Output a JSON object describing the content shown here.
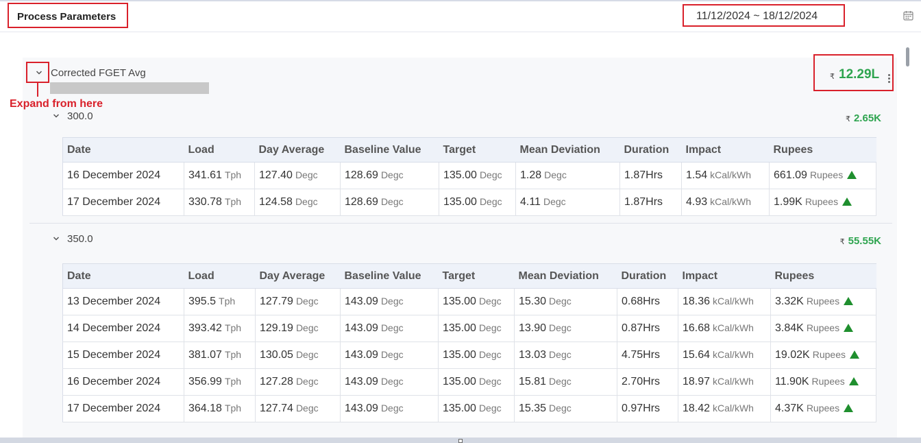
{
  "header": {
    "title": "Process Parameters",
    "date_range": "11/12/2024 ~ 18/12/2024"
  },
  "group": {
    "label": "Corrected FGET Avg",
    "currency_symbol": "₹",
    "total": "12.29L",
    "annotation": "Expand from here"
  },
  "columns": [
    "Date",
    "Load",
    "Day Average",
    "Baseline Value",
    "Target",
    "Mean Deviation",
    "Duration",
    "Impact",
    "Rupees"
  ],
  "sections": [
    {
      "label": "300.0",
      "amount": "2.65K",
      "rows": [
        {
          "date": "16 December 2024",
          "load": "341.61",
          "load_unit": "Tph",
          "day_avg": "127.40",
          "day_avg_unit": "Degc",
          "baseline": "128.69",
          "baseline_unit": "Degc",
          "target": "135.00",
          "target_unit": "Degc",
          "mean_dev": "1.28",
          "mean_dev_unit": "Degc",
          "duration": "1.87Hrs",
          "impact": "1.54",
          "impact_unit": "kCal/kWh",
          "rupees": "661.09",
          "rupees_unit": "Rupees"
        },
        {
          "date": "17 December 2024",
          "load": "330.78",
          "load_unit": "Tph",
          "day_avg": "124.58",
          "day_avg_unit": "Degc",
          "baseline": "128.69",
          "baseline_unit": "Degc",
          "target": "135.00",
          "target_unit": "Degc",
          "mean_dev": "4.11",
          "mean_dev_unit": "Degc",
          "duration": "1.87Hrs",
          "impact": "4.93",
          "impact_unit": "kCal/kWh",
          "rupees": "1.99K",
          "rupees_unit": "Rupees"
        }
      ]
    },
    {
      "label": "350.0",
      "amount": "55.55K",
      "rows": [
        {
          "date": "13 December 2024",
          "load": "395.5",
          "load_unit": "Tph",
          "day_avg": "127.79",
          "day_avg_unit": "Degc",
          "baseline": "143.09",
          "baseline_unit": "Degc",
          "target": "135.00",
          "target_unit": "Degc",
          "mean_dev": "15.30",
          "mean_dev_unit": "Degc",
          "duration": "0.68Hrs",
          "impact": "18.36",
          "impact_unit": "kCal/kWh",
          "rupees": "3.32K",
          "rupees_unit": "Rupees"
        },
        {
          "date": "14 December 2024",
          "load": "393.42",
          "load_unit": "Tph",
          "day_avg": "129.19",
          "day_avg_unit": "Degc",
          "baseline": "143.09",
          "baseline_unit": "Degc",
          "target": "135.00",
          "target_unit": "Degc",
          "mean_dev": "13.90",
          "mean_dev_unit": "Degc",
          "duration": "0.87Hrs",
          "impact": "16.68",
          "impact_unit": "kCal/kWh",
          "rupees": "3.84K",
          "rupees_unit": "Rupees"
        },
        {
          "date": "15 December 2024",
          "load": "381.07",
          "load_unit": "Tph",
          "day_avg": "130.05",
          "day_avg_unit": "Degc",
          "baseline": "143.09",
          "baseline_unit": "Degc",
          "target": "135.00",
          "target_unit": "Degc",
          "mean_dev": "13.03",
          "mean_dev_unit": "Degc",
          "duration": "4.75Hrs",
          "impact": "15.64",
          "impact_unit": "kCal/kWh",
          "rupees": "19.02K",
          "rupees_unit": "Rupees"
        },
        {
          "date": "16 December 2024",
          "load": "356.99",
          "load_unit": "Tph",
          "day_avg": "127.28",
          "day_avg_unit": "Degc",
          "baseline": "143.09",
          "baseline_unit": "Degc",
          "target": "135.00",
          "target_unit": "Degc",
          "mean_dev": "15.81",
          "mean_dev_unit": "Degc",
          "duration": "2.70Hrs",
          "impact": "18.97",
          "impact_unit": "kCal/kWh",
          "rupees": "11.90K",
          "rupees_unit": "Rupees"
        },
        {
          "date": "17 December 2024",
          "load": "364.18",
          "load_unit": "Tph",
          "day_avg": "127.74",
          "day_avg_unit": "Degc",
          "baseline": "143.09",
          "baseline_unit": "Degc",
          "target": "135.00",
          "target_unit": "Degc",
          "mean_dev": "15.35",
          "mean_dev_unit": "Degc",
          "duration": "0.97Hrs",
          "impact": "18.42",
          "impact_unit": "kCal/kWh",
          "rupees": "4.37K",
          "rupees_unit": "Rupees"
        }
      ]
    }
  ],
  "colors": {
    "positive": "#2ea44f",
    "annotation": "#d9202a",
    "up_arrow": "#1f8f2e"
  }
}
